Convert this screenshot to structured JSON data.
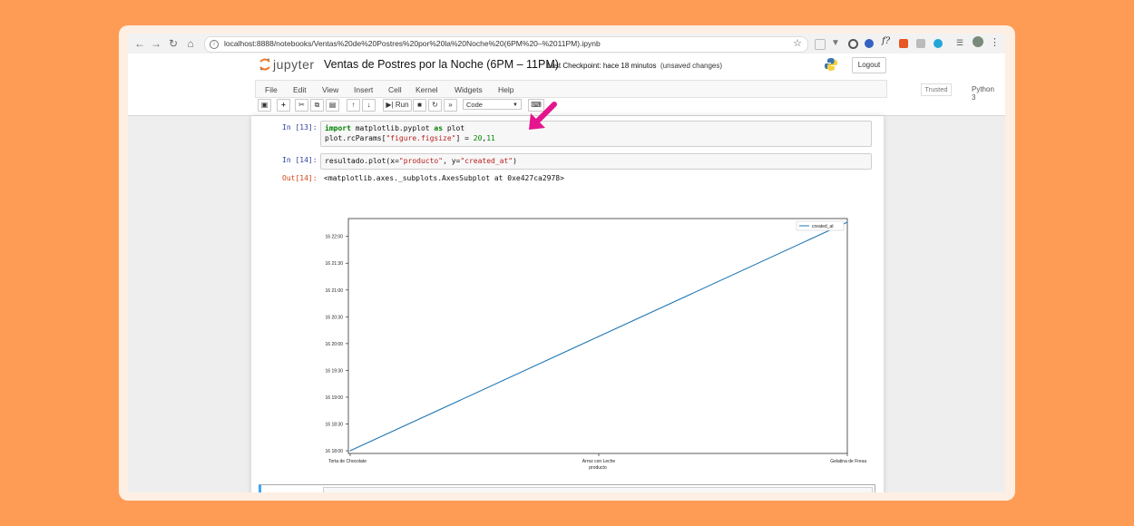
{
  "browser": {
    "url": "localhost:8888/notebooks/Ventas%20de%20Postres%20por%20la%20Noche%20(6PM%20–%2011PM).ipynb"
  },
  "header": {
    "logo_text": "jupyter",
    "notebook_title": "Ventas de Postres por la Noche (6PM – 11PM)",
    "checkpoint": "Last Checkpoint: hace 18 minutos",
    "unsaved": "(unsaved changes)",
    "logout": "Logout"
  },
  "menu": {
    "items": [
      "File",
      "Edit",
      "View",
      "Insert",
      "Cell",
      "Kernel",
      "Widgets",
      "Help"
    ],
    "trusted": "Trusted",
    "kernel": "Python 3"
  },
  "toolbar": {
    "run_label": "Run",
    "cell_type": "Code"
  },
  "cells": [
    {
      "prompt": "In [13]:",
      "code": [
        "import matplotlib.pyplot as plot",
        "plot.rcParams[\"figure.figsize\"] = 20,11"
      ]
    },
    {
      "prompt": "In [14]:",
      "code": [
        "resultado.plot(x=\"producto\", y=\"created_at\")"
      ],
      "out_prompt": "Out[14]:",
      "output": "<matplotlib.axes._subplots.AxesSubplot at 0xe427ca2978>"
    }
  ],
  "chart_data": {
    "type": "line",
    "categories": [
      "Torta de Chocolate",
      "Arroz con Leche",
      "Gelatina de Fresa"
    ],
    "series": [
      {
        "name": "created_at",
        "color": "#1f77b4",
        "values": [
          "16 18:00",
          "16 20:08",
          "16 22:16"
        ]
      }
    ],
    "y_tick_labels": [
      "16 18:00",
      "16 18:30",
      "16 19:00",
      "16 19:30",
      "16 20:00",
      "16 20:30",
      "16 21:00",
      "16 21:30",
      "16 22:00"
    ],
    "xlabel": "producto",
    "ylabel": "",
    "legend": "top-right",
    "grid": false
  }
}
